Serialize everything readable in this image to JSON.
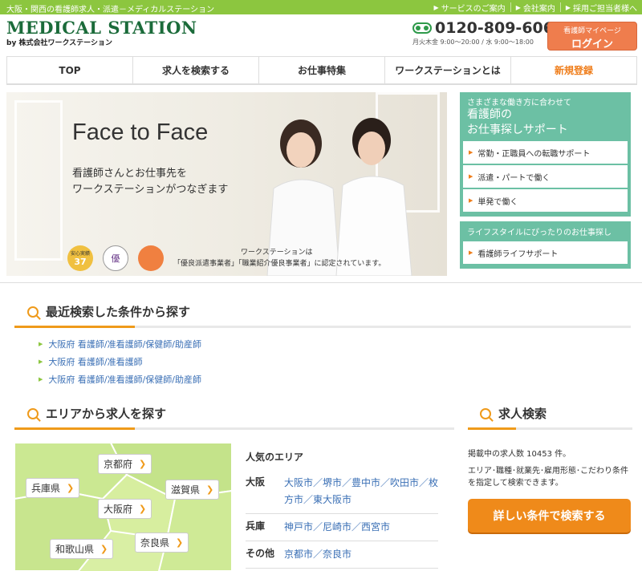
{
  "topbar": {
    "tagline": "大阪・関西の看護師求人・派遣－メディカルステーション",
    "links": [
      "サービスのご案内",
      "会社案内",
      "採用ご担当者様へ"
    ]
  },
  "logo": {
    "main": "MEDICAL STATION",
    "sub": "by 株式会社ワークステーション"
  },
  "phone": {
    "number": "0120-809-606",
    "hours": "月火木金 9:00〜20:00 / 水 9:00〜18:00"
  },
  "mypage": {
    "line1": "看護師マイページ",
    "line2": "ログイン"
  },
  "nav": [
    "TOP",
    "求人を検索する",
    "お仕事特集",
    "ワークステーションとは",
    "新規登録"
  ],
  "hero": {
    "title": "Face to Face",
    "copy1": "看護師さんとお仕事先を",
    "copy2": "ワークステーションがつなぎます",
    "cert1": "ワークステーションは",
    "cert2": "「優良派遣事業者」「職業紹介優良事業者」に認定されています。",
    "badge_text": "安心実績",
    "badge_num": "37",
    "badge2": "優"
  },
  "side": {
    "small": "さまざまな働き方に合わせて",
    "large1": "看護師の",
    "large2": "お仕事探しサポート",
    "items": [
      "常勤・正職員への転職サポート",
      "派遣・パートで働く",
      "単発で働く"
    ],
    "head2": "ライフスタイルにぴったりのお仕事探し",
    "item2": "看護師ライフサポート"
  },
  "recent": {
    "title": "最近検索した条件から探す",
    "items": [
      "大阪府 看護師/准看護師/保健師/助産師",
      "大阪府 看護師/准看護師",
      "大阪府 看護師/准看護師/保健師/助産師"
    ]
  },
  "area": {
    "title": "エリアから求人を探す",
    "prefs": [
      "京都府",
      "兵庫県",
      "滋賀県",
      "大阪府",
      "奈良県",
      "和歌山県"
    ],
    "popular_title": "人気のエリア",
    "rows": [
      {
        "key": "大阪",
        "val": "大阪市／堺市／豊中市／吹田市／枚方市／東大阪市"
      },
      {
        "key": "兵庫",
        "val": "神戸市／尼崎市／西宮市"
      },
      {
        "key": "その他",
        "val": "京都市／奈良市"
      }
    ]
  },
  "jobsearch": {
    "title": "求人検索",
    "count": "掲載中の求人数 10453 件。",
    "desc": "エリア･職種･就業先･雇用形態･こだわり条件を指定して検索できます。",
    "button": "詳しい条件で検索する"
  },
  "colors": {
    "green": "#8cc63f",
    "teal": "#6cc0a4",
    "orange": "#ef8a1a",
    "link": "#3a6fb5"
  }
}
